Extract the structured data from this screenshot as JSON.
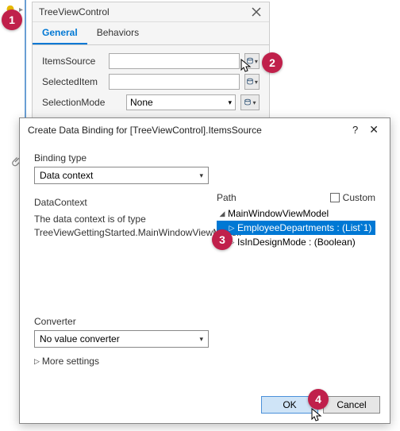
{
  "panel": {
    "title": "TreeViewControl",
    "tabs": {
      "general": "General",
      "behaviors": "Behaviors"
    },
    "props": {
      "itemsSource": {
        "label": "ItemsSource",
        "value": ""
      },
      "selectedItem": {
        "label": "SelectedItem",
        "value": ""
      },
      "selectionMode": {
        "label": "SelectionMode",
        "value": "None"
      }
    }
  },
  "dialog": {
    "title": "Create Data Binding for [TreeViewControl].ItemsSource",
    "help": "?",
    "bindingType": {
      "label": "Binding type",
      "value": "Data context"
    },
    "dataContext": {
      "label": "DataContext",
      "text": "The data context is of type TreeViewGettingStarted.MainWindowViewModel."
    },
    "path": {
      "label": "Path",
      "customLabel": "Custom",
      "root": "MainWindowViewModel",
      "item1": "EmployeeDepartments : (List`1)",
      "item2": "IsInDesignMode : (Boolean)"
    },
    "converter": {
      "label": "Converter",
      "value": "No value converter"
    },
    "more": "More settings",
    "ok": "OK",
    "cancel": "Cancel"
  },
  "badges": {
    "b1": "1",
    "b2": "2",
    "b3": "3",
    "b4": "4"
  }
}
